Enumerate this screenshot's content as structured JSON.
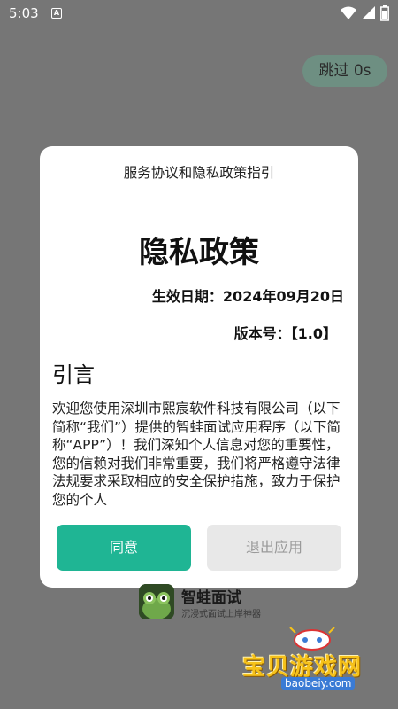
{
  "status_bar": {
    "time": "5:03",
    "icons": [
      "a-notification-icon",
      "wifi-icon",
      "signal-icon",
      "battery-icon"
    ]
  },
  "skip_button": {
    "label": "跳过 0s"
  },
  "dialog": {
    "title": "服务协议和隐私政策指引",
    "heading": "隐私政策",
    "effective_date": "生效日期：2024年09月20日",
    "version": "版本号：【1.0】",
    "intro_title": "引言",
    "intro_text": "欢迎您使用深圳市熙宸软件科技有限公司（以下简称“我们”）提供的智蛙面试应用程序（以下简称“APP”）！我们深知个人信息对您的重要性，您的信赖对我们非常重要，我们将严格遵守法律法规要求采取相应的安全保护措施，致力于保护您的个人",
    "agree_label": "同意",
    "exit_label": "退出应用"
  },
  "app_branding": {
    "name": "智蛙面试",
    "slogan": "沉浸式面试上岸神器"
  },
  "watermark": {
    "text": "宝贝游戏网",
    "url": "baobeiy.com"
  },
  "colors": {
    "accent": "#1fb594",
    "overlay": "#767676",
    "skip_bg": "#6e8f82"
  }
}
